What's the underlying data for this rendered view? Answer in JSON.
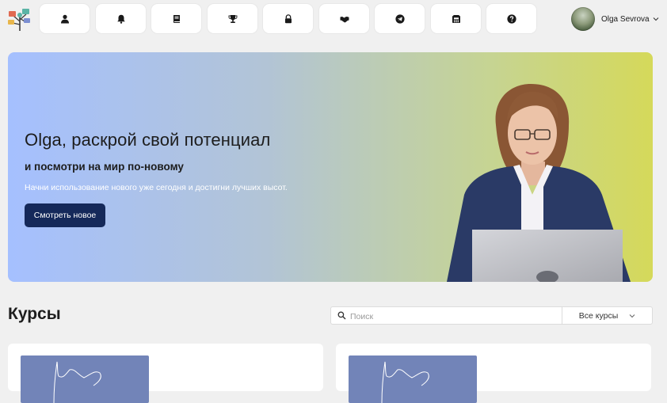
{
  "nav": {
    "items": [
      {
        "icon": "user-icon"
      },
      {
        "icon": "bell-icon"
      },
      {
        "icon": "book-icon"
      },
      {
        "icon": "trophy-icon"
      },
      {
        "icon": "lock-icon"
      },
      {
        "icon": "handshake-icon"
      },
      {
        "icon": "telegram-icon"
      },
      {
        "icon": "phone-icon"
      },
      {
        "icon": "help-icon"
      }
    ]
  },
  "user": {
    "name": "Olga Sevrova"
  },
  "hero": {
    "title": "Olga, раскрой свой потенциал",
    "subtitle": "и посмотри на мир по-новому",
    "text": "Начни использование нового уже сегодня и достигни лучших высот.",
    "button_label": "Смотреть новое"
  },
  "courses": {
    "title": "Курсы",
    "search_placeholder": "Поиск",
    "filter_value": "Все курсы"
  },
  "colors": {
    "primary_button": "#15295a",
    "hero_gradient_start": "#a5c0ff",
    "hero_gradient_end": "#d5d95a"
  }
}
